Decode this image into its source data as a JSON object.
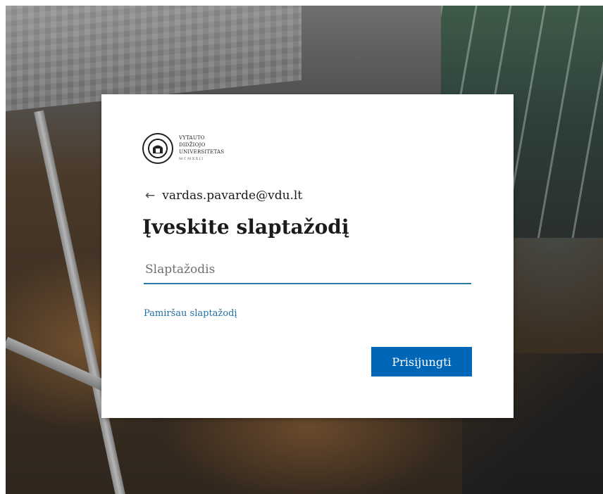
{
  "logo": {
    "seal_icon": "university-seal-icon",
    "line1": "VYTAUTO",
    "line2": "DIDŽIOJO",
    "line3": "UNIVERSITETAS",
    "line4": "MCMXXII"
  },
  "identity": {
    "back_icon": "left-arrow-icon",
    "email": "vardas.pavarde@vdu.lt"
  },
  "title": "Įveskite slaptažodį",
  "password": {
    "placeholder": "Slaptažodis",
    "value": ""
  },
  "forgot_link": "Pamiršau slaptažodį",
  "signin_button": "Prisijungti",
  "colors": {
    "accent": "#0067b8",
    "link": "#1f6fa3",
    "input_underline": "#2a7aa8",
    "text": "#1b1b1b"
  }
}
